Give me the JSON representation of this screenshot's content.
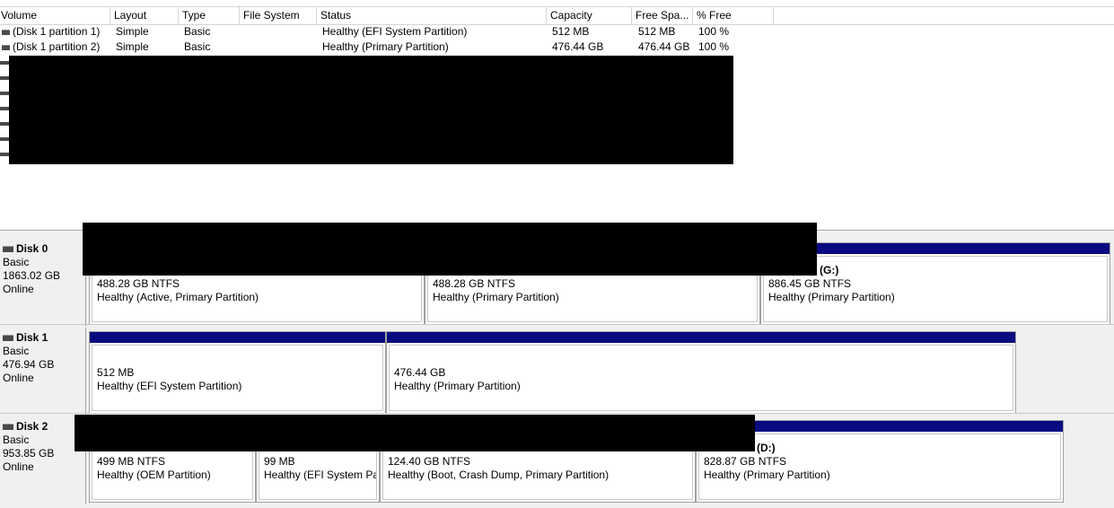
{
  "columns": [
    "Volume",
    "Layout",
    "Type",
    "File System",
    "Status",
    "Capacity",
    "Free Spa...",
    "% Free"
  ],
  "volumes": [
    {
      "volume": "(Disk 1 partition 1)",
      "layout": "Simple",
      "type": "Basic",
      "fs": "",
      "status": "Healthy (EFI System Partition)",
      "capacity": "512 MB",
      "free": "512 MB",
      "pct": "100 %"
    },
    {
      "volume": "(Disk 1 partition 2)",
      "layout": "Simple",
      "type": "Basic",
      "fs": "",
      "status": "Healthy (Primary Partition)",
      "capacity": "476.44 GB",
      "free": "476.44 GB",
      "pct": "100 %"
    }
  ],
  "disks": [
    {
      "name": "Disk 0",
      "type": "Basic",
      "size": "1863.02 GB",
      "state": "Online",
      "partitions": [
        {
          "vol": "",
          "size": "488.28 GB NTFS",
          "status": "Healthy (Active, Primary Partition)"
        },
        {
          "vol": "",
          "size": "488.28 GB NTFS",
          "status": "Healthy (Primary Partition)"
        },
        {
          "vol": "(G:)",
          "size": "886.45 GB NTFS",
          "status": "Healthy (Primary Partition)"
        }
      ]
    },
    {
      "name": "Disk 1",
      "type": "Basic",
      "size": "476.94 GB",
      "state": "Online",
      "partitions": [
        {
          "vol": "",
          "size": "512 MB",
          "status": "Healthy (EFI System Partition)"
        },
        {
          "vol": "",
          "size": "476.44 GB",
          "status": "Healthy (Primary Partition)"
        }
      ]
    },
    {
      "name": "Disk 2",
      "type": "Basic",
      "size": "953.85 GB",
      "state": "Online",
      "partitions": [
        {
          "vol": "",
          "size": "499 MB NTFS",
          "status": "Healthy (OEM Partition)"
        },
        {
          "vol": "",
          "size": "99 MB",
          "status": "Healthy (EFI System Par"
        },
        {
          "vol": "",
          "size": "124.40 GB NTFS",
          "status": "Healthy (Boot, Crash Dump, Primary Partition)"
        },
        {
          "vol": "(D:)",
          "size": "828.87 GB NTFS",
          "status": "Healthy (Primary Partition)"
        }
      ]
    }
  ],
  "colors": {
    "partition_bar": "#0a0a80",
    "redaction": "#000000"
  }
}
